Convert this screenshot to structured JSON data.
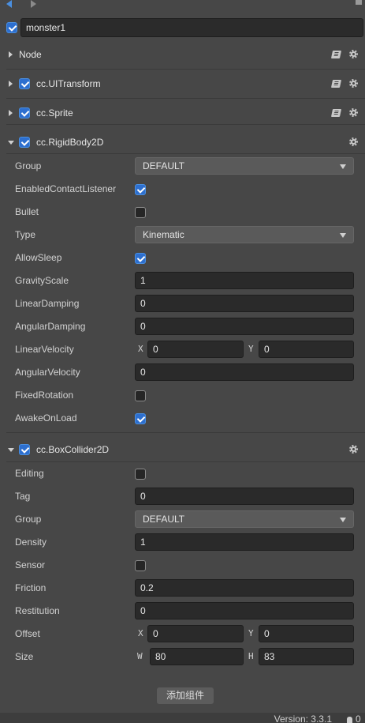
{
  "node_name": "monster1",
  "node_enabled": true,
  "components": {
    "node": {
      "title": "Node"
    },
    "ui_transform": {
      "title": "cc.UITransform",
      "enabled": true
    },
    "sprite": {
      "title": "cc.Sprite",
      "enabled": true
    },
    "rigidbody2d": {
      "title": "cc.RigidBody2D",
      "enabled": true,
      "props": {
        "group_label": "Group",
        "group_value": "DEFAULT",
        "enabled_contact_listener_label": "EnabledContactListener",
        "enabled_contact_listener": true,
        "bullet_label": "Bullet",
        "bullet": false,
        "type_label": "Type",
        "type_value": "Kinematic",
        "allow_sleep_label": "AllowSleep",
        "allow_sleep": true,
        "gravity_scale_label": "GravityScale",
        "gravity_scale": "1",
        "linear_damping_label": "LinearDamping",
        "linear_damping": "0",
        "angular_damping_label": "AngularDamping",
        "angular_damping": "0",
        "linear_velocity_label": "LinearVelocity",
        "linear_velocity_x_label": "X",
        "linear_velocity_x": "0",
        "linear_velocity_y_label": "Y",
        "linear_velocity_y": "0",
        "angular_velocity_label": "AngularVelocity",
        "angular_velocity": "0",
        "fixed_rotation_label": "FixedRotation",
        "fixed_rotation": false,
        "awake_on_load_label": "AwakeOnLoad",
        "awake_on_load": true
      }
    },
    "boxcollider2d": {
      "title": "cc.BoxCollider2D",
      "enabled": true,
      "props": {
        "editing_label": "Editing",
        "editing": false,
        "tag_label": "Tag",
        "tag": "0",
        "group_label": "Group",
        "group_value": "DEFAULT",
        "density_label": "Density",
        "density": "1",
        "sensor_label": "Sensor",
        "sensor": false,
        "friction_label": "Friction",
        "friction": "0.2",
        "restitution_label": "Restitution",
        "restitution": "0",
        "offset_label": "Offset",
        "offset_x_label": "X",
        "offset_x": "0",
        "offset_y_label": "Y",
        "offset_y": "0",
        "size_label": "Size",
        "size_w_label": "W",
        "size_w": "80",
        "size_h_label": "H",
        "size_h": "83"
      }
    }
  },
  "add_component_label": "添加组件",
  "version_text": "Version: 3.3.1",
  "notification_count": "0",
  "colors": {
    "accent": "#2d6fcf",
    "panel_bg": "#474747",
    "input_bg": "#2a2a2a",
    "select_bg": "#5a5a5a"
  }
}
